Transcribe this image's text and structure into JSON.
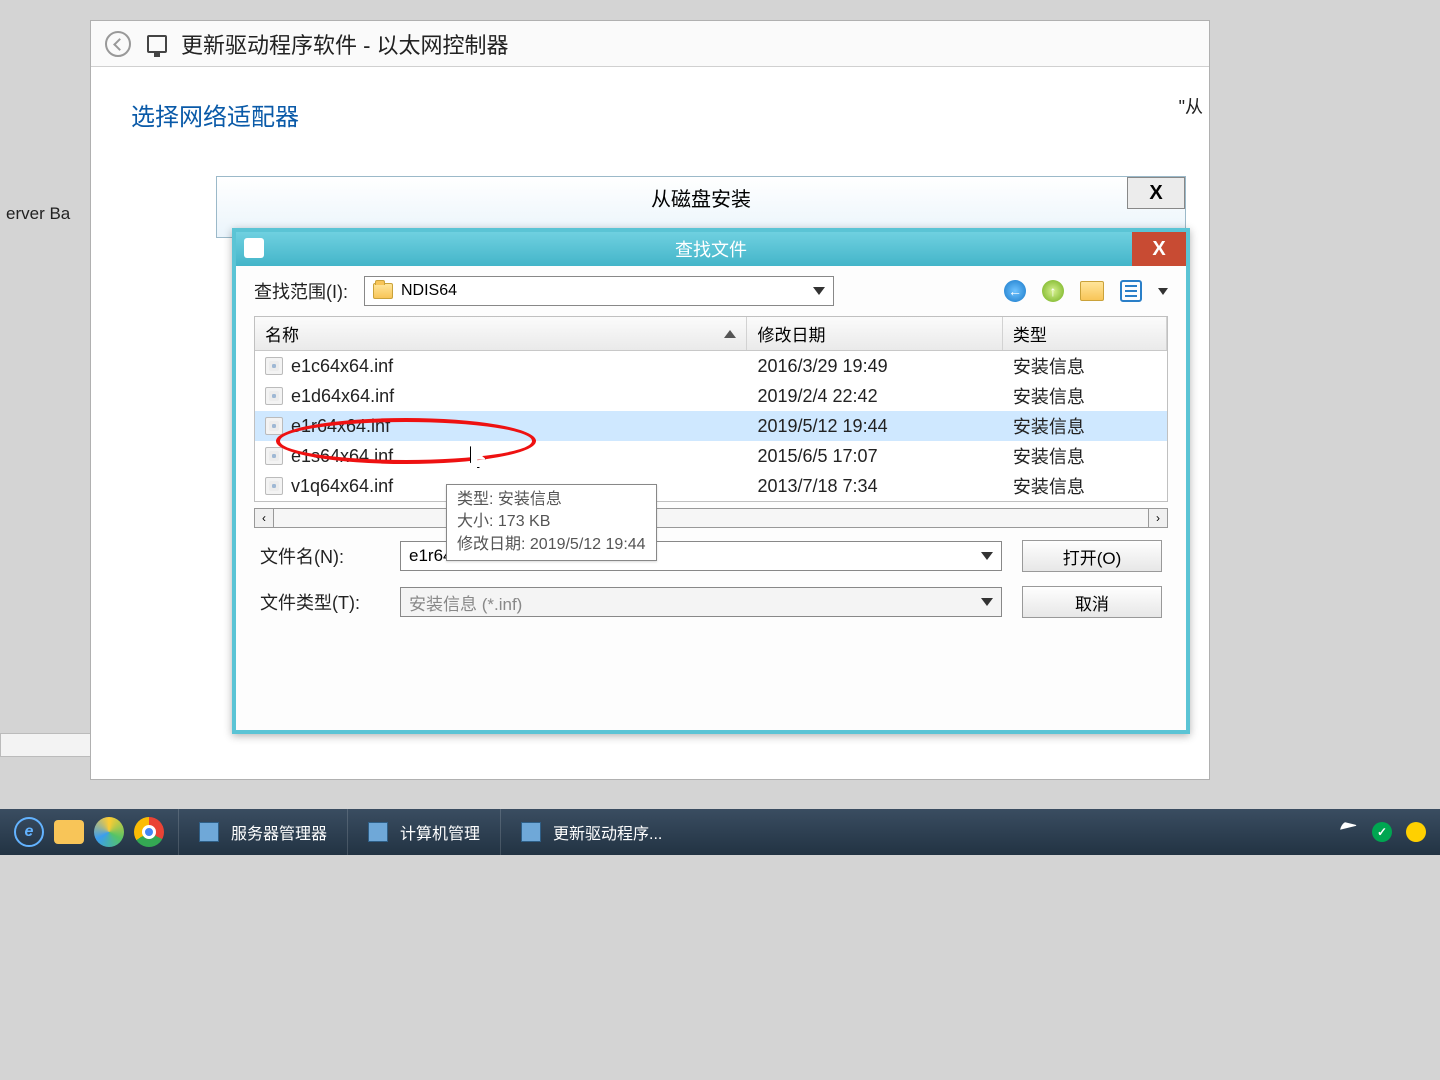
{
  "wizard": {
    "title": "更新驱动程序软件 - 以太网控制器",
    "heading": "选择网络适配器",
    "from_hint": "\"从"
  },
  "bg_left": {
    "line1": "erver Ba",
    "line2": ""
  },
  "disk_dialog": {
    "title": "从磁盘安装",
    "close": "X"
  },
  "find_dialog": {
    "title": "查找文件",
    "close": "X",
    "lookin_label": "查找范围(I):",
    "folder": "NDIS64",
    "columns": {
      "name": "名称",
      "date": "修改日期",
      "type": "类型"
    },
    "rows": [
      {
        "name": "e1c64x64.inf",
        "date": "2016/3/29 19:49",
        "type": "安装信息",
        "selected": false
      },
      {
        "name": "e1d64x64.inf",
        "date": "2019/2/4 22:42",
        "type": "安装信息",
        "selected": false
      },
      {
        "name": "e1r64x64.inf",
        "date": "2019/5/12 19:44",
        "type": "安装信息",
        "selected": true
      },
      {
        "name": "e1s64x64.inf",
        "date": "2015/6/5 17:07",
        "type": "安装信息",
        "selected": false
      },
      {
        "name": "v1q64x64.inf",
        "date": "2013/7/18 7:34",
        "type": "安装信息",
        "selected": false
      }
    ],
    "tooltip": {
      "line1": "类型: 安装信息",
      "line2": "大小: 173 KB",
      "line3": "修改日期: 2019/5/12 19:44"
    },
    "filename_label": "文件名(N):",
    "filename_value": "e1r64x64.inf",
    "filter_label": "文件类型(T):",
    "filter_value": "安装信息 (*.inf)",
    "open_btn": "打开(O)",
    "cancel_btn": "取消"
  },
  "taskbar": {
    "tasks": [
      {
        "label": "服务器管理器"
      },
      {
        "label": "计算机管理"
      },
      {
        "label": "更新驱动程序..."
      }
    ]
  }
}
